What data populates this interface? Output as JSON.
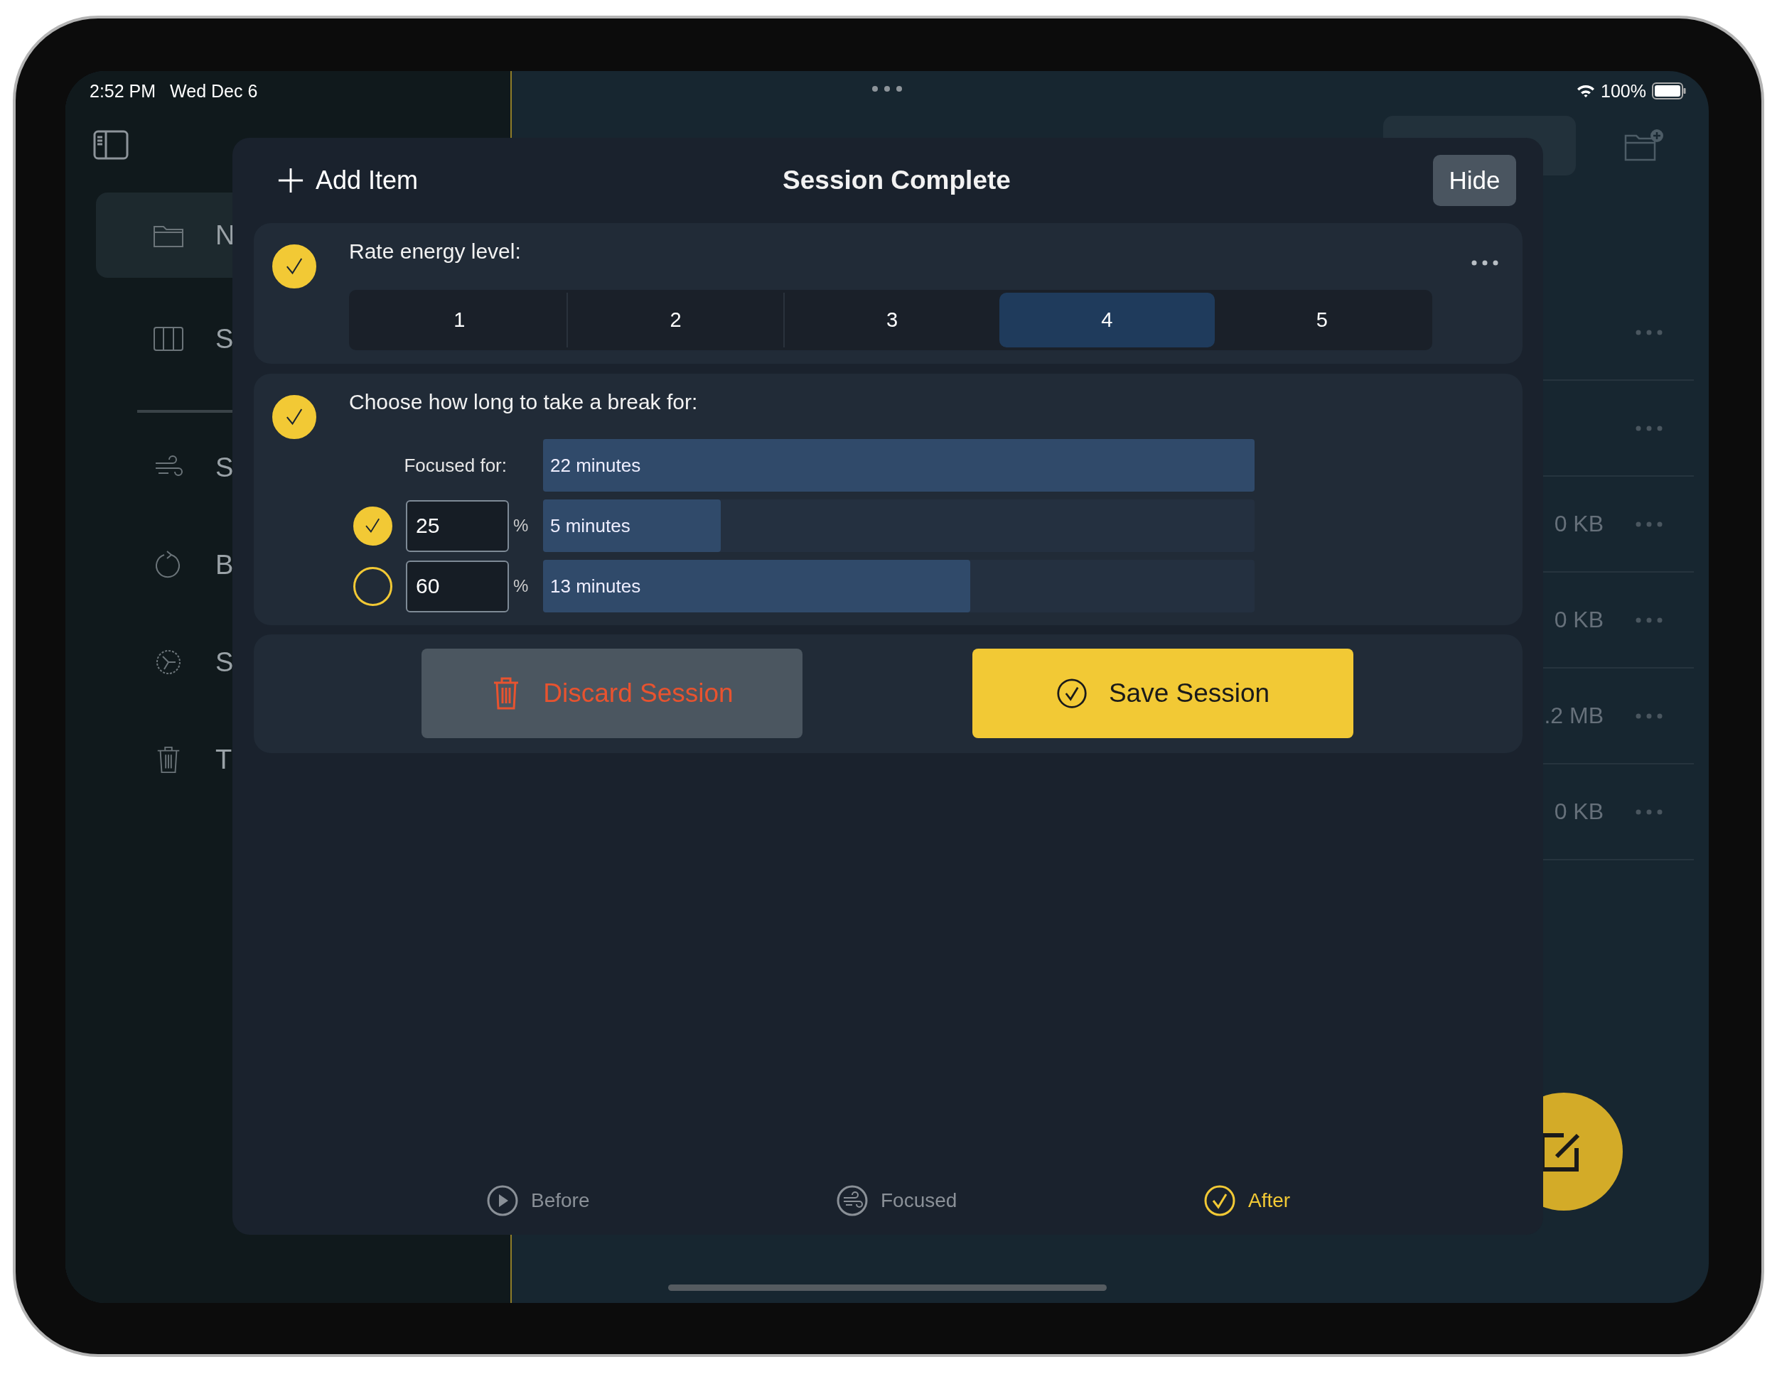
{
  "status_bar": {
    "time": "2:52 PM",
    "date": "Wed Dec 6",
    "battery": "100%"
  },
  "sidebar": {
    "sections": [
      {
        "items": [
          {
            "label": "N",
            "selected": true
          },
          {
            "label": "S",
            "selected": false
          }
        ]
      },
      {
        "items": [
          {
            "label": "S",
            "selected": false
          },
          {
            "label": "B",
            "selected": false
          },
          {
            "label": "S",
            "selected": false
          },
          {
            "label": "T",
            "selected": false
          }
        ]
      }
    ]
  },
  "file_list": {
    "rows": [
      {
        "kind": "folder"
      },
      {
        "kind": "folder"
      },
      {
        "kind": "file",
        "size": "0 KB"
      },
      {
        "kind": "file",
        "size": "0 KB"
      },
      {
        "kind": "file",
        "size": ".2 MB"
      },
      {
        "kind": "file",
        "size": "0 KB"
      }
    ]
  },
  "sheet": {
    "title": "Session Complete",
    "add_item": "Add Item",
    "hide": "Hide",
    "energy": {
      "label": "Rate energy level:",
      "checked": true,
      "options": [
        {
          "label": "1",
          "selected": false
        },
        {
          "label": "2",
          "selected": false
        },
        {
          "label": "3",
          "selected": false
        },
        {
          "label": "4",
          "selected": true
        },
        {
          "label": "5",
          "selected": false
        }
      ]
    },
    "break": {
      "label": "Choose how long to take a break for:",
      "checked": true,
      "focused_label": "Focused for:",
      "focused_value": "22 minutes",
      "options": [
        {
          "selected": true,
          "percent": "25",
          "unit": "%",
          "result": "5 minutes",
          "level": 0.25
        },
        {
          "selected": false,
          "percent": "60",
          "unit": "%",
          "result": "13 minutes",
          "level": 0.6
        }
      ]
    },
    "discard": "Discard Session",
    "save": "Save Session",
    "tabs": [
      {
        "label": "Before",
        "selected": false
      },
      {
        "label": "Focused",
        "selected": false
      },
      {
        "label": "After",
        "selected": true
      }
    ]
  }
}
